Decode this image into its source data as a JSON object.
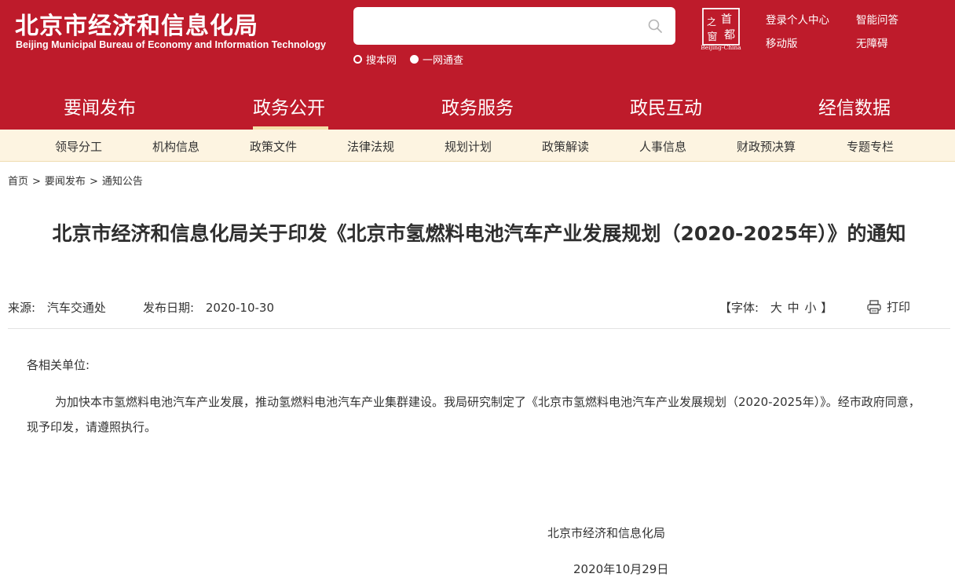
{
  "header": {
    "title_cn": "北京市经济和信息化局",
    "title_en": "Beijing Municipal Bureau of Economy and Information Technology",
    "search": {
      "value": "",
      "placeholder": "",
      "options": [
        {
          "label": "搜本网",
          "selected": false
        },
        {
          "label": "一网通查",
          "selected": true
        }
      ]
    },
    "emblem": {
      "chars": [
        "首",
        "都",
        "之",
        "窗"
      ],
      "subtitle": "Beijing-China"
    },
    "links": {
      "login": "登录个人中心",
      "qa": "智能问答",
      "mobile": "移动版",
      "accessible": "无障碍"
    },
    "colors": {
      "brand_red": "#be1b2b",
      "subnav_bg": "#fdf4e1",
      "active_underline": "#f4dfa8"
    }
  },
  "mainnav": {
    "items": [
      "要闻发布",
      "政务公开",
      "政务服务",
      "政民互动",
      "经信数据"
    ],
    "active": "政务公开"
  },
  "subnav": {
    "items": [
      "领导分工",
      "机构信息",
      "政策文件",
      "法律法规",
      "规划计划",
      "政策解读",
      "人事信息",
      "财政预决算",
      "专题专栏"
    ]
  },
  "breadcrumb": [
    "首页",
    "要闻发布",
    "通知公告"
  ],
  "breadcrumb_sep": ">",
  "article": {
    "title": "北京市经济和信息化局关于印发《北京市氢燃料电池汽车产业发展规划（2020-2025年）》的通知",
    "source_label": "来源:",
    "source": "汽车交通处",
    "date_label": "发布日期:",
    "date": "2020-10-30",
    "fontsize_open": "【字体:",
    "fontsize_options": [
      "大",
      "中",
      "小"
    ],
    "fontsize_close": "】",
    "print_label": "打印",
    "salutation": "各相关单位:",
    "body": "为加快本市氢燃料电池汽车产业发展，推动氢燃料电池汽车产业集群建设。我局研究制定了《北京市氢燃料电池汽车产业发展规划（2020-2025年）》。经市政府同意，现予印发，请遵照执行。",
    "sign_org": "北京市经济和信息化局",
    "sign_date": "2020年10月29日"
  }
}
